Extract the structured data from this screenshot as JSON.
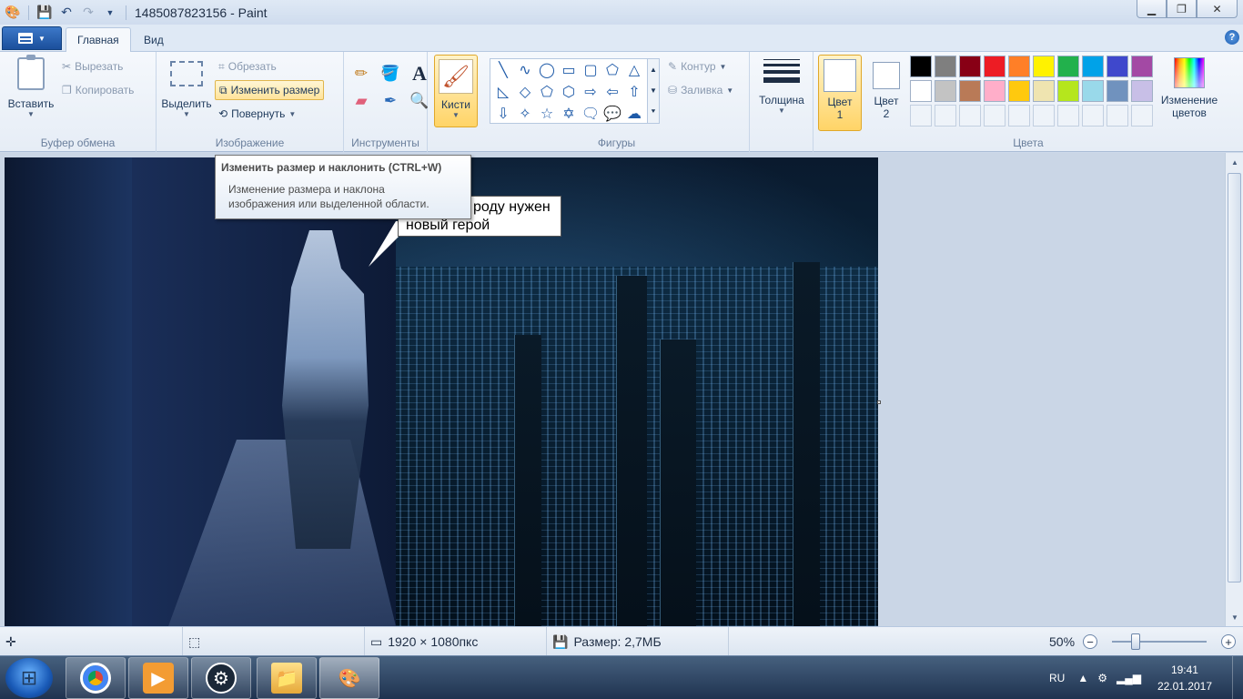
{
  "window": {
    "title": "1485087823156 - Paint"
  },
  "tabs": [
    {
      "label": "Главная"
    },
    {
      "label": "Вид"
    }
  ],
  "ribbon": {
    "clipboard": {
      "paste": "Вставить",
      "cut": "Вырезать",
      "copy": "Копировать",
      "group": "Буфер обмена"
    },
    "image": {
      "select": "Выделить",
      "crop": "Обрезать",
      "resize": "Изменить размер",
      "rotate": "Повернуть",
      "group": "Изображение"
    },
    "tools": {
      "group": "Инструменты"
    },
    "brushes": {
      "label": "Кисти"
    },
    "shapes": {
      "outline": "Контур",
      "fill": "Заливка",
      "group": "Фигуры"
    },
    "thickness": {
      "label": "Толщина"
    },
    "colors": {
      "color1_line1": "Цвет",
      "color1_line2": "1",
      "color2_line1": "Цвет",
      "color2_line2": "2",
      "edit_line1": "Изменение",
      "edit_line2": "цветов",
      "group": "Цвета",
      "color1": "#ffffff",
      "color2": "#ffffff",
      "palette": [
        "#000000",
        "#7f7f7f",
        "#880015",
        "#ed1c24",
        "#ff7f27",
        "#fff200",
        "#22b14c",
        "#00a2e8",
        "#3f48cc",
        "#a349a4",
        "#ffffff",
        "#c3c3c3",
        "#b97a57",
        "#ffaec9",
        "#ffc90e",
        "#efe4b0",
        "#b5e61d",
        "#99d9ea",
        "#7092be",
        "#c8bfe7"
      ]
    }
  },
  "tooltip": {
    "title": "Изменить размер и наклонить (CTRL+W)",
    "line1": "Изменение размера и наклона",
    "line2": "изображения или выделенной области."
  },
  "canvas": {
    "bubble_line1": "роду нужен",
    "bubble_line2": "новый герой"
  },
  "status": {
    "dimensions": "1920 × 1080пкс",
    "size": "Размер: 2,7МБ",
    "zoom": "50%",
    "zoom_level": 0.5
  },
  "taskbar": {
    "lang": "RU",
    "time": "19:41",
    "date": "22.01.2017"
  }
}
